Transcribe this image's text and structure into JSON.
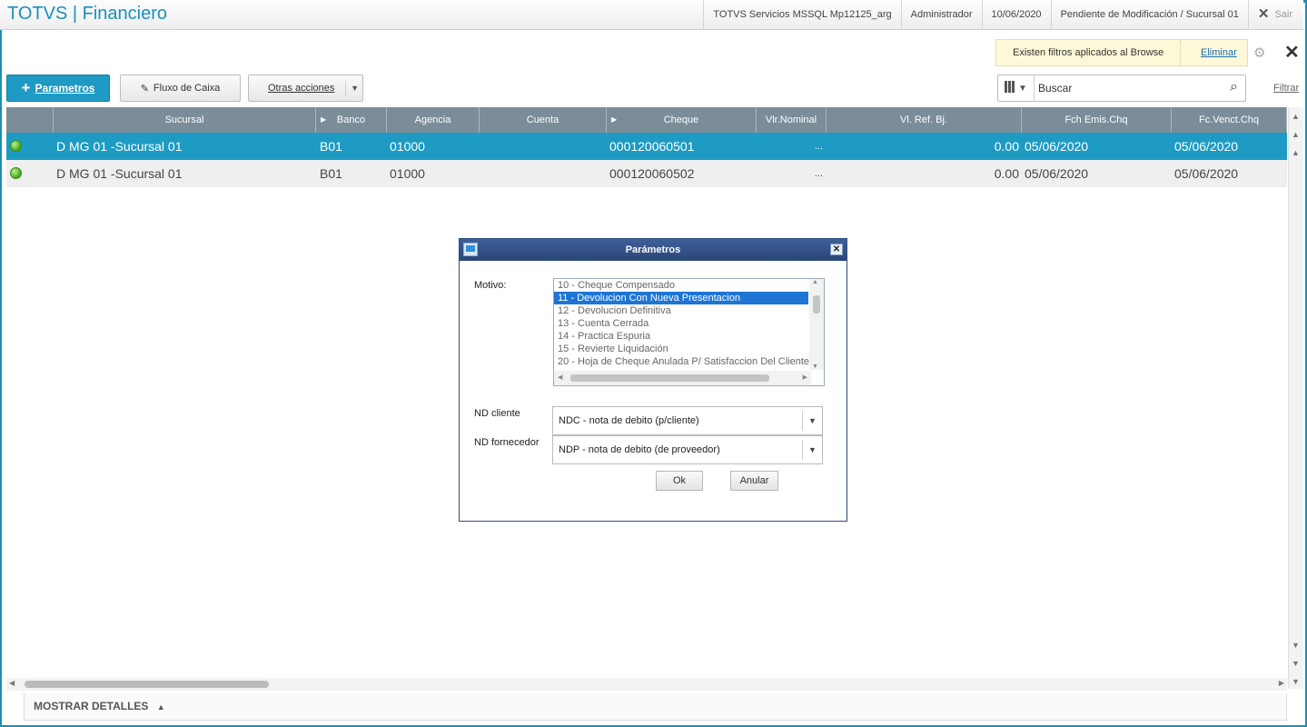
{
  "header": {
    "app_title": "TOTVS | Financiero",
    "server": "TOTVS Servicios MSSQL Mp12125_arg",
    "user": "Administrador",
    "date": "10/06/2020",
    "status": "Pendiente de Modificación / Sucursal 01",
    "exit_label": "Sair"
  },
  "filter_notice": {
    "message": "Existen filtros aplicados al Browse",
    "remove_label": "Eliminar"
  },
  "toolbar": {
    "parametros_label": "Parametros",
    "flux_label": "Fluxo de Caixa",
    "otras_label": "Otras acciones",
    "search_value": "Buscar",
    "filter_label": "Filtrar"
  },
  "grid": {
    "columns": [
      "",
      "Sucursal",
      "Banco",
      "Agencia",
      "Cuenta",
      "Cheque",
      "Vlr.Nominal",
      "Vl. Ref. Bj.",
      "Fch Emis.Chq",
      "Fc.Venct.Chq"
    ],
    "rows": [
      {
        "sucursal": "D MG 01 -Sucursal 01",
        "banco": "B01",
        "agencia": "01000",
        "cuenta": "",
        "cheque": "000120060501",
        "nominal": "...",
        "ref": "0.00",
        "emis": "05/06/2020",
        "venct": "05/06/2020"
      },
      {
        "sucursal": "D MG 01 -Sucursal 01",
        "banco": "B01",
        "agencia": "01000",
        "cuenta": "",
        "cheque": "000120060502",
        "nominal": "...",
        "ref": "0.00",
        "emis": "05/06/2020",
        "venct": "05/06/2020"
      }
    ]
  },
  "footer": {
    "details_label": "MOSTRAR DETALLES"
  },
  "dialog": {
    "title": "Parámetros",
    "motivo_label": "Motivo:",
    "motivo_options": [
      "10 - Cheque Compensado",
      "11 - Devolucion Con Nueva Presentacion",
      "12 - Devolucion Definitiva",
      "13 - Cuenta Cerrada",
      "14 - Practica Espuria",
      "15 - Revierte Liquidación",
      "20 - Hoja de Cheque Anulada P/ Satisfaccion Del Cliente"
    ],
    "nd_cliente_label": "ND cliente",
    "nd_cliente_value": "NDC - nota de debito (p/cliente)",
    "nd_fornecedor_label": "ND fornecedor",
    "nd_fornecedor_value": "NDP - nota de debito (de proveedor)",
    "ok_label": "Ok",
    "cancel_label": "Anular"
  }
}
